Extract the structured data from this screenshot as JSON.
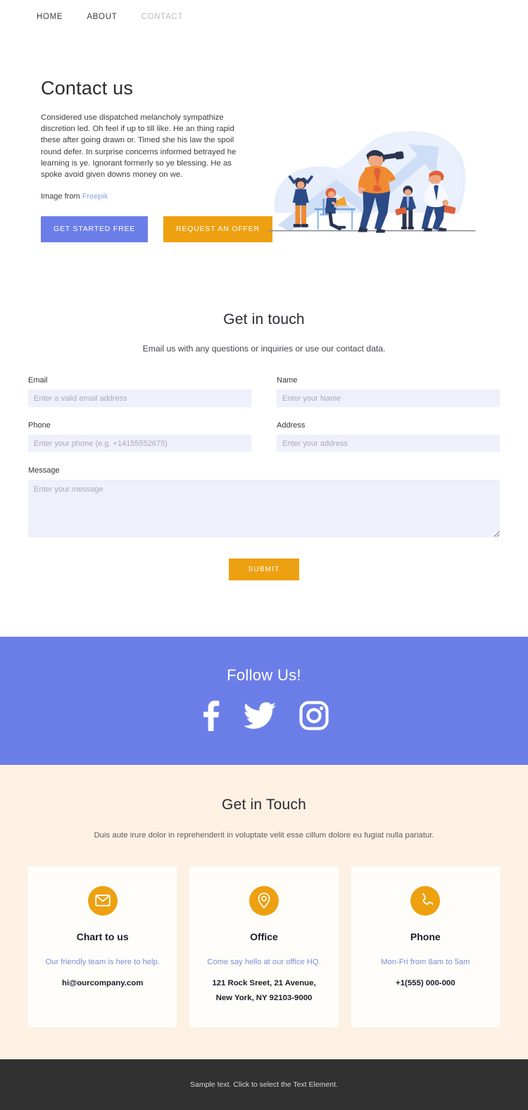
{
  "nav": {
    "items": [
      {
        "label": "HOME",
        "active": false
      },
      {
        "label": "ABOUT",
        "active": false
      },
      {
        "label": "CONTACT",
        "active": true
      }
    ]
  },
  "hero": {
    "title": "Contact us",
    "body": "Considered use dispatched melancholy sympathize discretion led. Oh feel if up to till like. He an thing rapid these after going drawn or. Timed she his law the spoil round defer. In surprise concerns informed betrayed he learning is ye. Ignorant formerly so ye blessing. He as spoke avoid given downs money on we.",
    "credit_prefix": "Image from ",
    "credit_link": "Freepik",
    "primary_button": "GET STARTED FREE",
    "secondary_button": "REQUEST AN OFFER",
    "illustration_name": "business-team-growth-illustration"
  },
  "form": {
    "title": "Get in touch",
    "subtitle": "Email us with any questions or inquiries or use our contact data.",
    "fields": [
      {
        "label": "Email",
        "placeholder": "Enter a valid email address",
        "value": ""
      },
      {
        "label": "Name",
        "placeholder": "Enter your Name",
        "value": ""
      },
      {
        "label": "Phone",
        "placeholder": "Enter your phone (e.g. +14155552675)",
        "value": ""
      },
      {
        "label": "Address",
        "placeholder": "Enter your address",
        "value": ""
      }
    ],
    "message": {
      "label": "Message",
      "placeholder": "Enter your message",
      "value": ""
    },
    "submit_label": "SUBMIT"
  },
  "follow": {
    "title": "Follow Us!",
    "social": [
      {
        "name": "facebook-icon"
      },
      {
        "name": "twitter-icon"
      },
      {
        "name": "instagram-icon"
      }
    ]
  },
  "contact": {
    "title": "Get in Touch",
    "subtitle": "Duis aute irure dolor in reprehenderit in voluptate velit esse cillum dolore eu fugiat nulla pariatur.",
    "cards": [
      {
        "icon": "envelope-icon",
        "title": "Chart to us",
        "note": "Our friendly team is here to help.",
        "value_line1": "hi@ourcompany.com",
        "value_line2": ""
      },
      {
        "icon": "map-pin-icon",
        "title": "Office",
        "note": "Come say hello at our office HQ.",
        "value_line1": "121 Rock Sreet, 21 Avenue,",
        "value_line2": "New York, NY 92103-9000"
      },
      {
        "icon": "phone-icon",
        "title": "Phone",
        "note": "Mon-Fri from 8am to 5am",
        "value_line1": "+1(555) 000-000",
        "value_line2": ""
      }
    ]
  },
  "footer": {
    "text": "Sample text. Click to select the Text Element."
  },
  "colors": {
    "accent_purple": "#6b7ee8",
    "accent_orange": "#eda010",
    "input_bg": "#eef0fb",
    "cream_bg": "#fdf1e4",
    "footer_bg": "#313131"
  }
}
